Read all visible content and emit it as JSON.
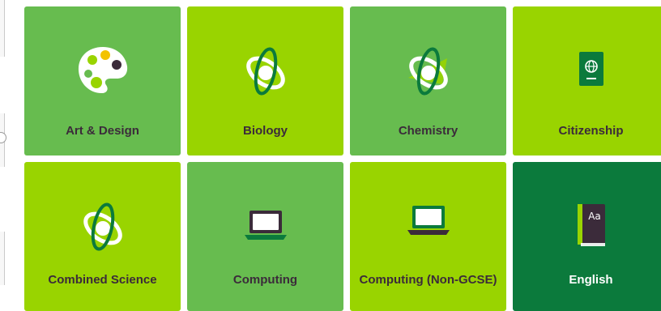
{
  "colors": {
    "tile_light": "#99d400",
    "tile_medium": "#67bc4f",
    "tile_dark": "#0b7a3c",
    "label_text": "#3b2b3a",
    "label_text_on_dark": "#ffffff"
  },
  "subjects": [
    {
      "label": "Art & Design",
      "icon": "palette-icon",
      "tone": "medium"
    },
    {
      "label": "Biology",
      "icon": "atom-icon",
      "tone": "light"
    },
    {
      "label": "Chemistry",
      "icon": "atom-icon",
      "tone": "medium"
    },
    {
      "label": "Citizenship",
      "icon": "passport-icon",
      "tone": "light"
    },
    {
      "label": "Combined Science",
      "icon": "atom-icon",
      "tone": "light"
    },
    {
      "label": "Computing",
      "icon": "laptop-icon",
      "tone": "medium"
    },
    {
      "label": "Computing (Non-GCSE)",
      "icon": "laptop-icon",
      "tone": "light"
    },
    {
      "label": "English",
      "icon": "book-icon",
      "tone": "dark"
    }
  ]
}
